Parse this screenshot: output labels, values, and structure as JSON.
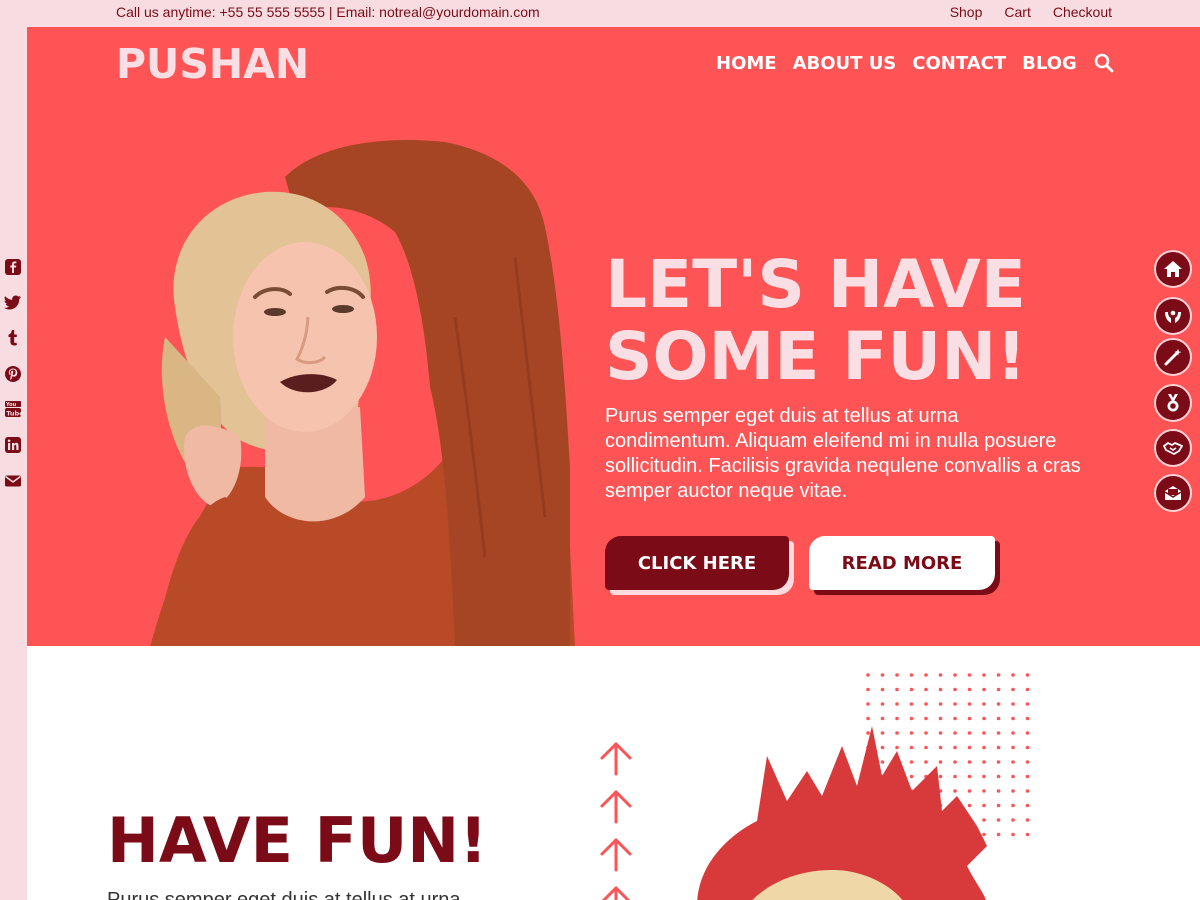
{
  "topbar": {
    "contact": "Call us anytime: +55 55 555 5555 | Email: notreal@yourdomain.com",
    "links": [
      "Shop",
      "Cart",
      "Checkout"
    ]
  },
  "brand": {
    "logo": "PUSHAN"
  },
  "nav": {
    "items": [
      "HOME",
      "ABOUT US",
      "CONTACT",
      "BLOG"
    ],
    "search_icon": "search-icon"
  },
  "hero": {
    "headline_line1": "LET'S HAVE",
    "headline_line2": "SOME FUN!",
    "paragraph": "Purus semper eget duis at tellus at urna condimentum. Aliquam eleifend mi in nulla posuere sollicitudin. Facilisis gravida nequlene convallis a cras semper auctor neque vitae.",
    "primary_button": "CLICK HERE",
    "secondary_button": "READ MORE"
  },
  "social_icons": [
    "facebook-icon",
    "twitter-icon",
    "tumblr-icon",
    "pinterest-icon",
    "youtube-icon",
    "linkedin-icon",
    "email-icon"
  ],
  "side_icons": [
    "home-icon",
    "hands-icon",
    "magic-wand-icon",
    "medal-icon",
    "handshake-icon",
    "envelope-icon"
  ],
  "lower": {
    "title": "HAVE FUN!",
    "paragraph_start": "Purus semper eget duis at tellus at urna"
  },
  "colors": {
    "primary": "#fe5455",
    "dark": "#7a0b17",
    "light_pink": "#f7dde2"
  }
}
